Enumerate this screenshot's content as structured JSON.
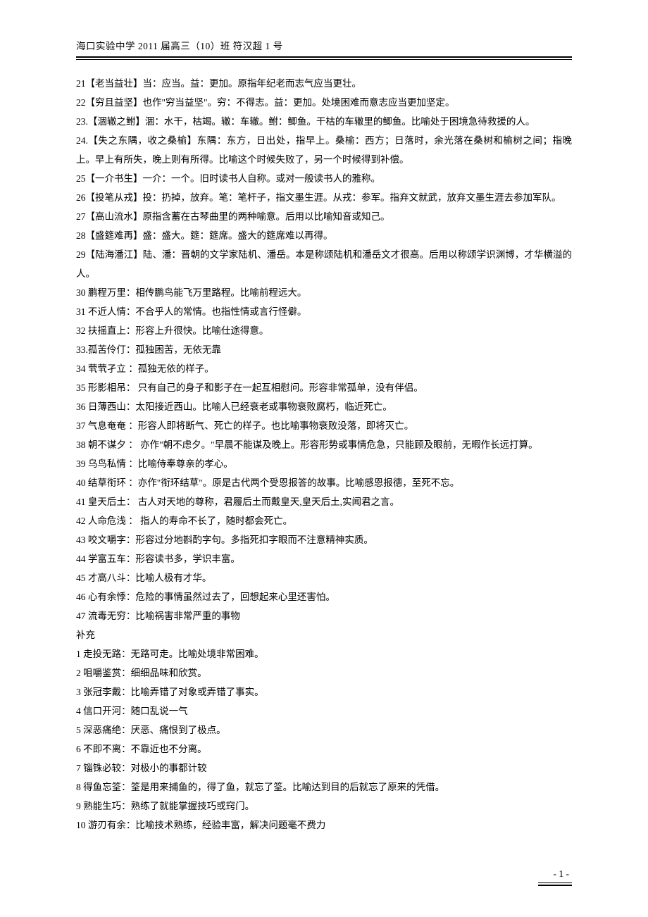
{
  "header": "海口实验中学 2011 届高三（10）班 符汉超 1 号",
  "entries": [
    "21【老当益壮】当：应当。益：更加。原指年纪老而志气应当更壮。",
    "22【穷且益坚】也作\"穷当益坚\"。穷：不得志。益：更加。处境困难而意志应当更加坚定。",
    "23.【涸辙之鲋】涸：水干，枯竭。辙：车辙。鲋：鲫鱼。干枯的车辙里的鲫鱼。比喻处于困境急待救援的人。",
    "24.【失之东隅，收之桑榆】东隅：东方，日出处，指早上。桑榆：西方；日落时，余光落在桑树和榆树之间；指晚上。早上有所失，晚上则有所得。比喻这个时候失败了，另一个时候得到补偿。",
    "25【一介书生】一介：一个。旧时读书人自称。或对一般读书人的雅称。",
    "26【投笔从戎】投：扔掉，放弃。笔：笔杆子，指文墨生涯。从戎：参军。指弃文就武，放弃文墨生涯去参加军队。",
    "27【高山流水】原指含蓄在古琴曲里的两种喻意。后用以比喻知音或知己。",
    "28【盛筵难再】盛：盛大。筵：筵席。盛大的筵席难以再得。",
    "29【陆海潘江】陆、潘：晋朝的文学家陆机、潘岳。本是称颂陆机和潘岳文才很高。后用以称颂学识渊博，才华横溢的人。",
    "30 鹏程万里：相传鹏鸟能飞万里路程。比喻前程远大。",
    "31 不近人情：不合乎人的常情。也指性情或言行怪僻。",
    "32 扶摇直上：形容上升很快。比喻仕途得意。",
    "33.孤苦伶仃：孤独困苦，无依无靠",
    "34 茕茕孑立 ：孤独无依的样子。",
    "35 形影相吊： 只有自己的身子和影子在一起互相慰问。形容非常孤单，没有伴侣。",
    "36 日薄西山：太阳接近西山。比喻人已经衰老或事物衰败腐朽，临近死亡。",
    "37 气息奄奄 ：形容人即将断气、死亡的样子。也比喻事物衰败没落，即将灭亡。",
    "38 朝不谋夕 ： 亦作\"朝不虑夕。\"早晨不能谋及晚上。形容形势或事情危急，只能顾及眼前，无暇作长远打算。",
    "39 乌鸟私情 ：比喻侍奉尊亲的孝心。",
    "40  结草衔环 ：亦作\"衔环结草\"。原是古代两个受恩报答的故事。比喻感恩报德，至死不忘。",
    "41 皇天后土： 古人对天地的尊称，君履后土而戴皇天,皇天后土,实闻君之言。",
    "42 人命危浅 ： 指人的寿命不长了，随时都会死亡。",
    "43 咬文嚼字：形容过分地斟酌字句。多指死扣字眼而不注意精神实质。",
    "44 学富五车：形容读书多，学识丰富。",
    "45 才高八斗：比喻人极有才华。",
    "46 心有余悸：危险的事情虽然过去了，回想起来心里还害怕。",
    "47 流毒无穷：比喻祸害非常严重的事物"
  ],
  "supplementLabel": "补充",
  "supplement": [
    "1 走投无路：无路可走。比喻处境非常困难。",
    "2 咀嚼鉴赏：细细品味和欣赏。",
    "3 张冠李戴：比喻弄错了对象或弄错了事实。",
    "4 信口开河：随口乱说一气",
    "5 深恶痛绝：厌恶、痛恨到了极点。",
    "6 不即不离：不靠近也不分离。",
    "7 锱铢必较：对极小的事都计较",
    "8 得鱼忘筌：筌是用来捕鱼的，得了鱼，就忘了筌。比喻达到目的后就忘了原来的凭借。",
    "9 熟能生巧：熟练了就能掌握技巧或窍门。",
    "10 游刃有余：比喻技术熟练，经验丰富，解决问题毫不费力"
  ],
  "pageNumber": "- 1 -"
}
